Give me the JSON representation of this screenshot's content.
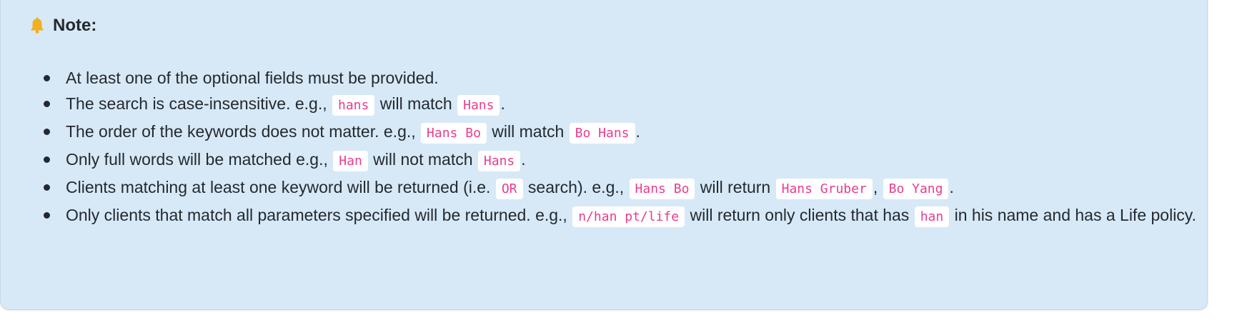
{
  "note": {
    "icon": "bell-icon",
    "title": "Note:",
    "colors": {
      "background": "#d7e9f7",
      "code_text": "#e83e8c",
      "code_background": "#ffffff",
      "bell": "#f2b01e"
    },
    "items": [
      {
        "t1": "At least one of the optional fields must be provided."
      },
      {
        "t1": "The search is case-insensitive. e.g., ",
        "c1": "hans",
        "t2": " will match ",
        "c2": "Hans",
        "t3": "."
      },
      {
        "t1": "The order of the keywords does not matter. e.g., ",
        "c1": "Hans Bo",
        "t2": " will match ",
        "c2": "Bo Hans",
        "t3": "."
      },
      {
        "t1": "Only full words will be matched e.g., ",
        "c1": "Han",
        "t2": " will not match ",
        "c2": "Hans",
        "t3": "."
      },
      {
        "t1": "Clients matching at least one keyword will be returned (i.e. ",
        "c1": "OR",
        "t2": " search). e.g., ",
        "c2": "Hans Bo",
        "t3": " will return ",
        "c3": "Hans Gruber",
        "t4": ", ",
        "c4": "Bo Yang",
        "t5": "."
      },
      {
        "t1": "Only clients that match all parameters specified will be returned. e.g., ",
        "c1": "n/han pt/life",
        "t2": " will return only clients that has ",
        "c2": "han",
        "t3": " in his name and has a Life policy."
      }
    ]
  }
}
